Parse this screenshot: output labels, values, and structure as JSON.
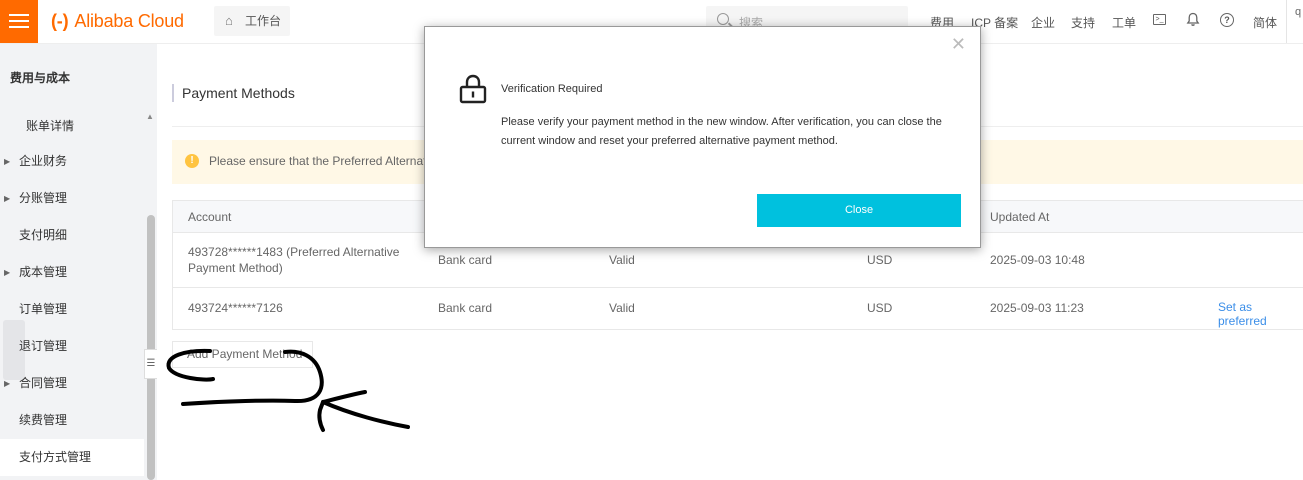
{
  "topbar": {
    "logo_text": "Alibaba Cloud",
    "logo_mark": "(-)",
    "workbench_label": "工作台",
    "search_placeholder": "搜索",
    "nav": [
      "费用",
      "ICP 备案",
      "企业",
      "支持",
      "工单"
    ],
    "lang": "简体",
    "user": "q"
  },
  "sidebar": {
    "title": "费用与成本",
    "items": [
      {
        "label": "账单详情",
        "has_arrow": false
      },
      {
        "label": "企业财务",
        "has_arrow": true
      },
      {
        "label": "分账管理",
        "has_arrow": true
      },
      {
        "label": "支付明细",
        "has_arrow": false
      },
      {
        "label": "成本管理",
        "has_arrow": true
      },
      {
        "label": "订单管理",
        "has_arrow": false
      },
      {
        "label": "退订管理",
        "has_arrow": false
      },
      {
        "label": "合同管理",
        "has_arrow": true
      },
      {
        "label": "续费管理",
        "has_arrow": false
      },
      {
        "label": "支付方式管理",
        "has_arrow": false
      }
    ]
  },
  "main": {
    "page_title": "Payment Methods",
    "alert_text": "Please ensure that the Preferred Alternativ",
    "table": {
      "headers": {
        "account": "Account",
        "updated_at": "Updated At"
      },
      "rows": [
        {
          "account_line1": "493728******1483 (Preferred Alternative",
          "account_line2": "Payment Method)",
          "type": "Bank card",
          "status": "Valid",
          "currency": "USD",
          "updated_at": "2025-09-03 10:48",
          "action": ""
        },
        {
          "account_line1": "493724******7126",
          "account_line2": "",
          "type": "Bank card",
          "status": "Valid",
          "currency": "USD",
          "updated_at": "2025-09-03 11:23",
          "action": "Set as preferred"
        }
      ]
    },
    "add_button": "Add Payment Method"
  },
  "modal": {
    "close_glyph": "✕",
    "title": "Verification Required",
    "body": "Please verify your payment method in the new window. After verification, you can close the current window and reset your preferred alternative payment method.",
    "close_button": "Close",
    "button_color": "#00c1de"
  },
  "colors": {
    "brand": "#ff6a00",
    "link": "#3b8ee8",
    "alert_bg": "#fff8e6"
  }
}
